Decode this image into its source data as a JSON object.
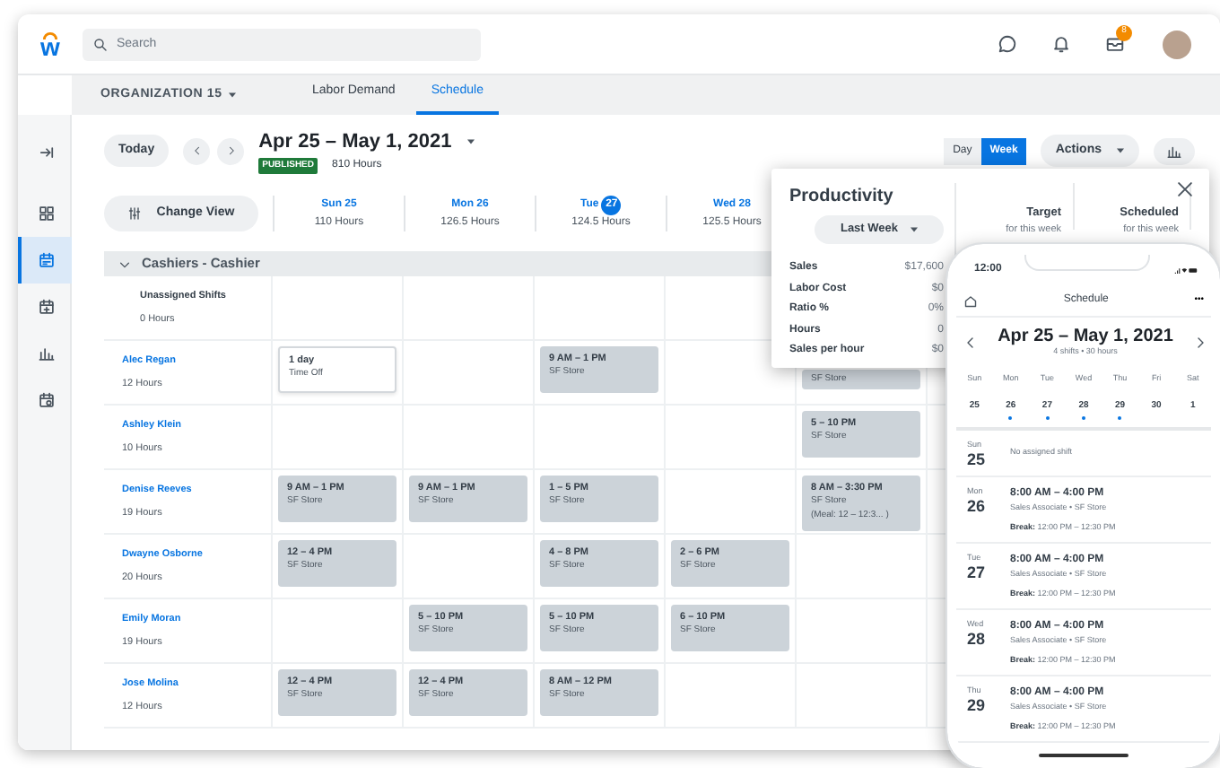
{
  "topbar": {
    "logo": "w",
    "search": {
      "placeholder": "Search"
    },
    "inbox_badge": "8"
  },
  "sidebar": [
    {
      "kind": "collapse",
      "selected": false
    },
    {
      "kind": "dashboard",
      "selected": false
    },
    {
      "kind": "schedule",
      "selected": true
    },
    {
      "kind": "calendar-add",
      "selected": false
    },
    {
      "kind": "chart",
      "selected": false
    },
    {
      "kind": "calendar-settings",
      "selected": false
    }
  ],
  "organization": "ORGANIZATION 15",
  "tabs": [
    {
      "label": "Labor Demand",
      "selected": false
    },
    {
      "label": "Schedule",
      "selected": true
    }
  ],
  "toolbar": {
    "today": "Today",
    "range": "Apr 25 – May 1, 2021",
    "status": "PUBLISHED",
    "hours": "810 Hours",
    "views": [
      {
        "label": "Day",
        "selected": false
      },
      {
        "label": "Week",
        "selected": true
      }
    ],
    "actions": "Actions"
  },
  "grid": {
    "change_view": "Change View",
    "days": [
      {
        "day": "Sun",
        "date": "25",
        "hours": "110 Hours",
        "today": false
      },
      {
        "day": "Mon",
        "date": "26",
        "hours": "126.5 Hours",
        "today": false
      },
      {
        "day": "Tue",
        "date": "27",
        "hours": "124.5 Hours",
        "today": true
      },
      {
        "day": "Wed",
        "date": "28",
        "hours": "125.5 Hours",
        "today": false
      }
    ],
    "group": {
      "label": "Cashiers - Cashier",
      "expanded": true
    },
    "rows": [
      {
        "kind": "unassigned",
        "name": "Unassigned Shifts",
        "hours": "0 Hours",
        "shifts": [
          {
            "kind": "empty"
          },
          {
            "kind": "empty"
          },
          {
            "kind": "empty"
          },
          {
            "kind": "empty"
          },
          {
            "kind": "empty"
          }
        ]
      },
      {
        "kind": "employee",
        "name": "Alec Regan",
        "hours": "12 Hours",
        "shifts": [
          {
            "kind": "time_off",
            "title": "1 day",
            "detail": "Time Off"
          },
          {
            "kind": "empty"
          },
          {
            "kind": "shift",
            "title": "9 AM – 1 PM",
            "detail": "SF Store"
          },
          {
            "kind": "empty"
          },
          {
            "kind": "shift",
            "detail": "SF Store"
          }
        ]
      },
      {
        "kind": "employee",
        "name": "Ashley Klein",
        "hours": "10 Hours",
        "shifts": [
          {
            "kind": "empty"
          },
          {
            "kind": "empty"
          },
          {
            "kind": "empty"
          },
          {
            "kind": "empty"
          },
          {
            "kind": "shift",
            "title": "5 – 10 PM",
            "detail": "SF Store"
          }
        ]
      },
      {
        "kind": "employee",
        "name": "Denise Reeves",
        "hours": "19 Hours",
        "shifts": [
          {
            "kind": "shift",
            "title": "9 AM – 1 PM",
            "detail": "SF Store"
          },
          {
            "kind": "shift",
            "title": "9 AM – 1 PM",
            "detail": "SF Store"
          },
          {
            "kind": "shift",
            "title": "1 – 5 PM",
            "detail": "SF Store"
          },
          {
            "kind": "empty"
          },
          {
            "kind": "shift",
            "title": "8 AM – 3:30 PM",
            "detail": "SF Store",
            "note": "(Meal: 12 – 12:3... )"
          }
        ]
      },
      {
        "kind": "employee",
        "name": "Dwayne Osborne",
        "hours": "20 Hours",
        "shifts": [
          {
            "kind": "shift",
            "title": "12 – 4 PM",
            "detail": "SF Store"
          },
          {
            "kind": "empty"
          },
          {
            "kind": "shift",
            "title": "4 – 8 PM",
            "detail": "SF Store"
          },
          {
            "kind": "shift",
            "title": "2 – 6 PM",
            "detail": "SF Store"
          },
          {
            "kind": "empty"
          }
        ]
      },
      {
        "kind": "employee",
        "name": "Emily Moran",
        "hours": "19 Hours",
        "shifts": [
          {
            "kind": "empty"
          },
          {
            "kind": "shift",
            "title": "5 – 10 PM",
            "detail": "SF Store"
          },
          {
            "kind": "shift",
            "title": "5 – 10 PM",
            "detail": "SF Store"
          },
          {
            "kind": "shift",
            "title": "6 – 10 PM",
            "detail": "SF Store"
          },
          {
            "kind": "empty"
          }
        ]
      },
      {
        "kind": "employee",
        "name": "Jose Molina",
        "hours": "12 Hours",
        "shifts": [
          {
            "kind": "shift",
            "title": "12 – 4 PM",
            "detail": "SF Store"
          },
          {
            "kind": "shift",
            "title": "12 – 4 PM",
            "detail": "SF Store"
          },
          {
            "kind": "shift",
            "title": "8 AM – 12 PM",
            "detail": "SF Store"
          },
          {
            "kind": "empty"
          },
          {
            "kind": "empty"
          }
        ]
      }
    ]
  },
  "productivity": {
    "title": "Productivity",
    "period": "Last Week",
    "metrics": [
      {
        "label": "Sales",
        "value": "$17,600"
      },
      {
        "label": "Labor Cost",
        "value": "$0"
      },
      {
        "label": "Ratio %",
        "value": "0%"
      },
      {
        "label": "Hours",
        "value": "0"
      },
      {
        "label": "Sales per hour",
        "value": "$0"
      }
    ],
    "columns": [
      {
        "title": "Target",
        "subtitle": "for this week"
      },
      {
        "title": "Scheduled",
        "subtitle": "for this week"
      }
    ]
  },
  "phone": {
    "time": "12:00",
    "title": "Schedule",
    "more": "•••",
    "range": "Apr 25 – May 1, 2021",
    "summary": "4 shifts • 30 hours",
    "week": [
      {
        "dow": "Sun",
        "date": "25",
        "has_shift": false
      },
      {
        "dow": "Mon",
        "date": "26",
        "has_shift": true
      },
      {
        "dow": "Tue",
        "date": "27",
        "has_shift": true
      },
      {
        "dow": "Wed",
        "date": "28",
        "has_shift": true
      },
      {
        "dow": "Thu",
        "date": "29",
        "has_shift": true
      },
      {
        "dow": "Fri",
        "date": "30",
        "has_shift": false
      },
      {
        "dow": "Sat",
        "date": "1",
        "has_shift": false
      }
    ],
    "days": [
      {
        "kind": "empty",
        "dow": "Sun",
        "date": "25",
        "text": "No assigned shift"
      },
      {
        "kind": "shift",
        "dow": "Mon",
        "date": "26",
        "time": "8:00 AM – 4:00 PM",
        "detail": "Sales Associate • SF Store",
        "break": "**Break:** 12:00 PM – 12:30 PM"
      },
      {
        "kind": "shift",
        "dow": "Tue",
        "date": "27",
        "time": "8:00 AM – 4:00 PM",
        "detail": "Sales Associate • SF Store",
        "break": "**Break:** 12:00 PM – 12:30 PM"
      },
      {
        "kind": "shift",
        "dow": "Wed",
        "date": "28",
        "time": "8:00 AM – 4:00 PM",
        "detail": "Sales Associate • SF Store",
        "break": "**Break:** 12:00 PM – 12:30 PM"
      },
      {
        "kind": "shift",
        "dow": "Thu",
        "date": "29",
        "time": "8:00 AM – 4:00 PM",
        "detail": "Sales Associate • SF Store",
        "break": "**Break:** 12:00 PM – 12:30 PM"
      }
    ]
  }
}
